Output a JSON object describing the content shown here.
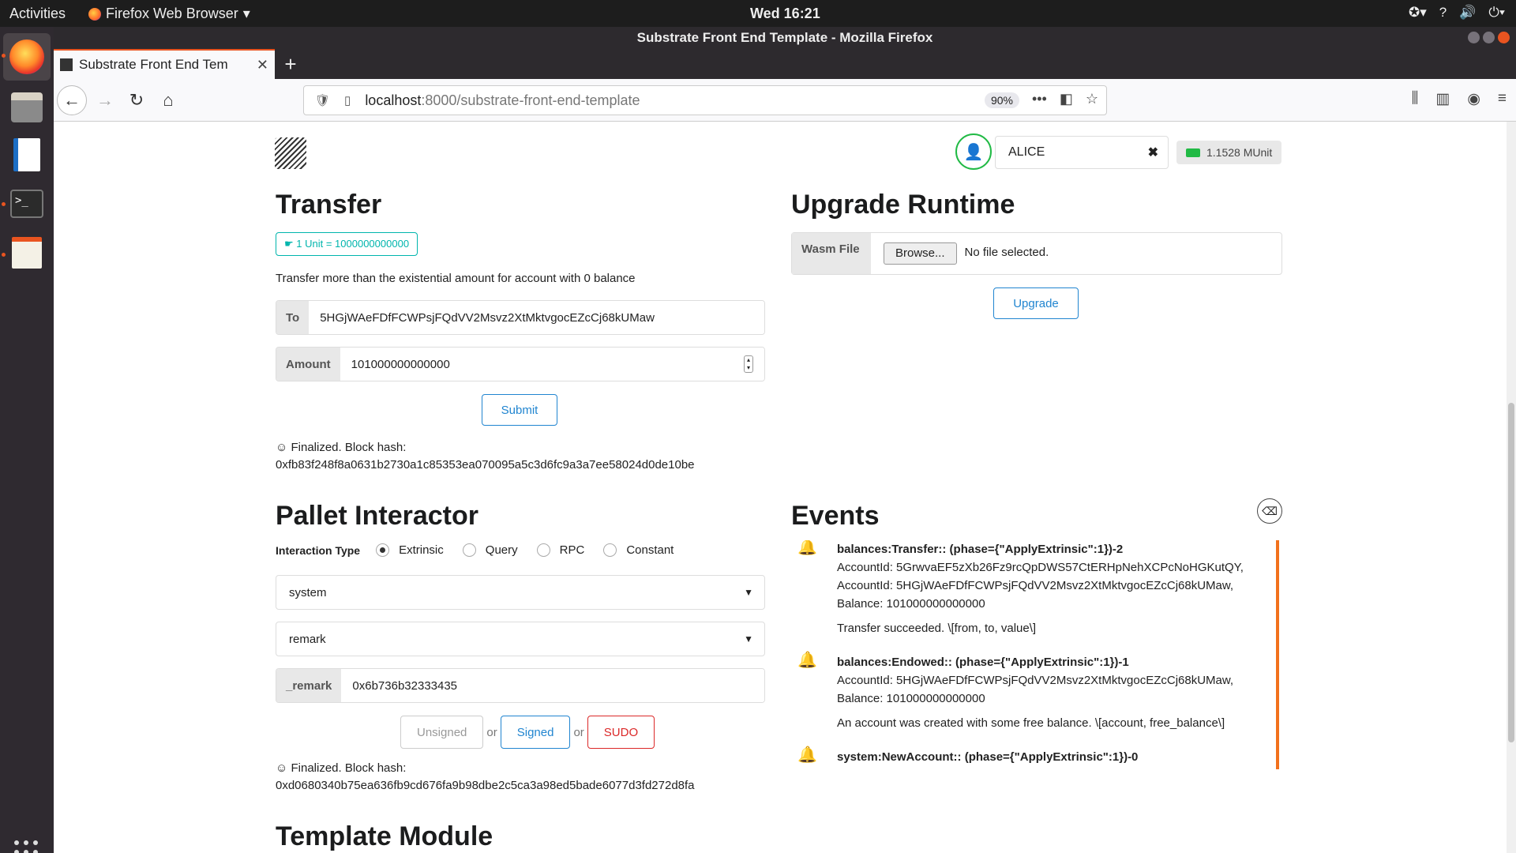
{
  "system": {
    "activities": "Activities",
    "app_menu": "Firefox Web Browser",
    "clock": "Wed 16:21"
  },
  "window": {
    "title": "Substrate Front End Template - Mozilla Firefox"
  },
  "browser": {
    "tab_title": "Substrate Front End Tem",
    "url_host": "localhost",
    "url_path": ":8000/substrate-front-end-template",
    "zoom": "90%"
  },
  "header": {
    "account_name": "ALICE",
    "balance": "1.1528 MUnit"
  },
  "transfer": {
    "title": "Transfer",
    "unit_label": "1 Unit = 1000000000000",
    "note": "Transfer more than the existential amount for account with 0 balance",
    "to_label": "To",
    "to_value": "5HGjWAeFDfFCWPsjFQdVV2Msvz2XtMktvgocEZcCj68kUMaw",
    "amount_label": "Amount",
    "amount_value": "101000000000000",
    "submit_label": "Submit",
    "status_line1": "☺ Finalized. Block hash:",
    "status_line2": "0xfb83f248f8a0631b2730a1c85353ea070095a5c3d6fc9a3a7ee58024d0de10be"
  },
  "upgrade": {
    "title": "Upgrade Runtime",
    "wasm_label": "Wasm File",
    "browse_label": "Browse...",
    "file_status": "No file selected.",
    "upgrade_label": "Upgrade"
  },
  "pallet": {
    "title": "Pallet Interactor",
    "interaction_label": "Interaction Type",
    "options": [
      "Extrinsic",
      "Query",
      "RPC",
      "Constant"
    ],
    "selected_option": "Extrinsic",
    "pallet_value": "system",
    "call_value": "remark",
    "param_label": "_remark",
    "param_value": "0x6b736b32333435",
    "unsigned_label": "Unsigned",
    "signed_label": "Signed",
    "sudo_label": "SUDO",
    "or_label": "or",
    "status_line1": "☺ Finalized. Block hash:",
    "status_line2": "0xd0680340b75ea636fb9cd676fa9b98dbe2c5ca3a98ed5bade6077d3fd272d8fa"
  },
  "events": {
    "title": "Events",
    "items": [
      {
        "head": "balances:Transfer:: (phase={\"ApplyExtrinsic\":1})-2",
        "lines": [
          "AccountId: 5GrwvaEF5zXb26Fz9rcQpDWS57CtERHpNehXCPcNoHGKutQY,",
          "AccountId: 5HGjWAeFDfFCWPsjFQdVV2Msvz2XtMktvgocEZcCj68kUMaw,",
          "Balance: 101000000000000"
        ],
        "desc": "Transfer succeeded. \\[from, to, value\\]"
      },
      {
        "head": "balances:Endowed:: (phase={\"ApplyExtrinsic\":1})-1",
        "lines": [
          "AccountId: 5HGjWAeFDfFCWPsjFQdVV2Msvz2XtMktvgocEZcCj68kUMaw,",
          "Balance: 101000000000000"
        ],
        "desc": "An account was created with some free balance. \\[account, free_balance\\]"
      },
      {
        "head": "system:NewAccount:: (phase={\"ApplyExtrinsic\":1})-0",
        "lines": [],
        "desc": ""
      }
    ]
  },
  "template_module": {
    "title": "Template Module"
  }
}
